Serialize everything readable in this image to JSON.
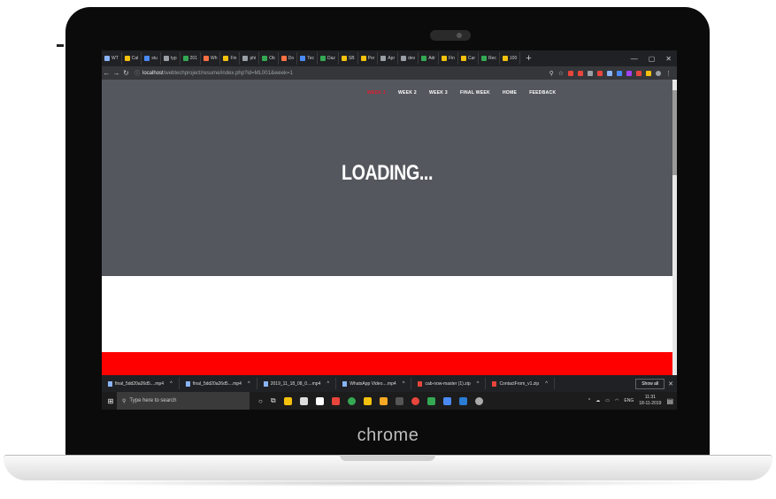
{
  "browser": {
    "tabs": [
      {
        "label": "WT",
        "color": "#8ab4f8"
      },
      {
        "label": "Cal",
        "color": "#f4c20d"
      },
      {
        "label": "stu",
        "color": "#4a8af4"
      },
      {
        "label": "typ",
        "color": "#9aa0a6"
      },
      {
        "label": "201",
        "color": "#34a853"
      },
      {
        "label": "Wh",
        "color": "#ff7043"
      },
      {
        "label": "Fin",
        "color": "#f4c20d"
      },
      {
        "label": "phi",
        "color": "#9aa0a6"
      },
      {
        "label": "Ob",
        "color": "#34a853"
      },
      {
        "label": "Do",
        "color": "#ff7043"
      },
      {
        "label": "Tec",
        "color": "#4a8af4"
      },
      {
        "label": "Daz",
        "color": "#34a853"
      },
      {
        "label": "SB",
        "color": "#f4c20d"
      },
      {
        "label": "Por",
        "color": "#f4c20d"
      },
      {
        "label": "Apr",
        "color": "#9aa0a6"
      },
      {
        "label": "dev",
        "color": "#9aa0a6"
      },
      {
        "label": "Adr",
        "color": "#34a853"
      },
      {
        "label": "Fin",
        "color": "#f4c20d"
      },
      {
        "label": "Car",
        "color": "#f4c20d"
      },
      {
        "label": "Rec",
        "color": "#34a853"
      },
      {
        "label": "100",
        "color": "#f4c20d"
      }
    ],
    "new_tab": "+",
    "url_host": "localhost",
    "url_path": "/webtechproject/resume/index.php?id=ML001&week=1"
  },
  "site": {
    "nav": [
      "WEEK 1",
      "WEEK 2",
      "WEEK 3",
      "FINAL WEEK",
      "HOME",
      "FEEDBACK"
    ],
    "active_nav": "WEEK 1",
    "loading_text": "LOADING..."
  },
  "downloads": {
    "items": [
      {
        "name": "final_5dd20a26d5....mp4",
        "type": "file"
      },
      {
        "name": "final_5dd20a26d5....mp4",
        "type": "file"
      },
      {
        "name": "2019_11_18_08_0....mp4",
        "type": "file"
      },
      {
        "name": "WhatsApp Video....mp4",
        "type": "file"
      },
      {
        "name": "cab-now-master (1).zip",
        "type": "zip"
      },
      {
        "name": "ContactFrom_v1.zip",
        "type": "zip"
      }
    ],
    "show_all": "Show all"
  },
  "taskbar": {
    "search_placeholder": "Type here to search",
    "lang": "ENG",
    "time": "11:31",
    "date": "18-11-2019"
  },
  "device": {
    "brand": "chrome"
  },
  "colors": {
    "hero": "#54585e",
    "accent_red": "#ff0000",
    "nav_active": "#e8192c"
  }
}
